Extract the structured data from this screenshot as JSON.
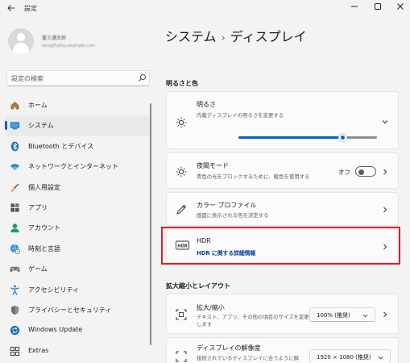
{
  "window": {
    "title": "設定",
    "back_icon": "arrow-left-icon",
    "controls": [
      "minimize-icon",
      "maximize-icon",
      "close-icon"
    ]
  },
  "profile": {
    "name": "富士通太郎",
    "email": "taro@fujitsu.example.com"
  },
  "search": {
    "placeholder": "設定の検索"
  },
  "sidebar": {
    "accent_color": "#0067c0",
    "items": [
      {
        "label": "ホーム",
        "icon": "home-icon",
        "active": false
      },
      {
        "label": "システム",
        "icon": "system-monitor-icon",
        "active": true
      },
      {
        "label": "Bluetooth とデバイス",
        "icon": "bluetooth-icon",
        "active": false
      },
      {
        "label": "ネットワークとインターネット",
        "icon": "wifi-icon",
        "active": false
      },
      {
        "label": "個人用設定",
        "icon": "paintbrush-icon",
        "active": false
      },
      {
        "label": "アプリ",
        "icon": "apps-icon",
        "active": false
      },
      {
        "label": "アカウント",
        "icon": "account-icon",
        "active": false
      },
      {
        "label": "時刻と言語",
        "icon": "globe-clock-icon",
        "active": false
      },
      {
        "label": "ゲーム",
        "icon": "gamepad-icon",
        "active": false
      },
      {
        "label": "アクセシビリティ",
        "icon": "accessibility-icon",
        "active": false
      },
      {
        "label": "プライバシーとセキュリティ",
        "icon": "shield-icon",
        "active": false
      },
      {
        "label": "Windows Update",
        "icon": "windows-update-icon",
        "active": false
      },
      {
        "label": "Extras",
        "icon": "extras-icon",
        "active": false
      }
    ]
  },
  "breadcrumb": {
    "parent": "システム",
    "separator": "›",
    "current": "ディスプレイ"
  },
  "sections": {
    "brightness_color": "明るさと色",
    "scale_layout": "拡大縮小とレイアウト"
  },
  "brightness": {
    "title": "明るさ",
    "subtitle": "内蔵ディスプレイの明るさを変更する",
    "level": 0.75,
    "icon": "sun-icon"
  },
  "night_light": {
    "title": "夜間モード",
    "subtitle": "青色の光をブロックするために、暖色を使用する",
    "state_label": "オフ",
    "enabled": false,
    "icon": "moon-sun-icon"
  },
  "color_profile": {
    "title": "カラー プロファイル",
    "subtitle": "画面に表示される色を決定する",
    "icon": "color-pen-icon"
  },
  "hdr": {
    "title": "HDR",
    "link": "HDR に関する詳細情報",
    "icon": "hdr-icon",
    "highlight_color": "#d2232a"
  },
  "scale": {
    "title": "拡大/縮小",
    "subtitle": "テキスト、アプリ、その他の項目のサイズを変更します",
    "value": "100% (推奨)",
    "icon": "scale-icon"
  },
  "resolution": {
    "title": "ディスプレイの解像度",
    "subtitle": "接続されているディスプレイに合うように解",
    "value": "1920 × 1080 (推奨)",
    "icon": "resolution-icon"
  }
}
